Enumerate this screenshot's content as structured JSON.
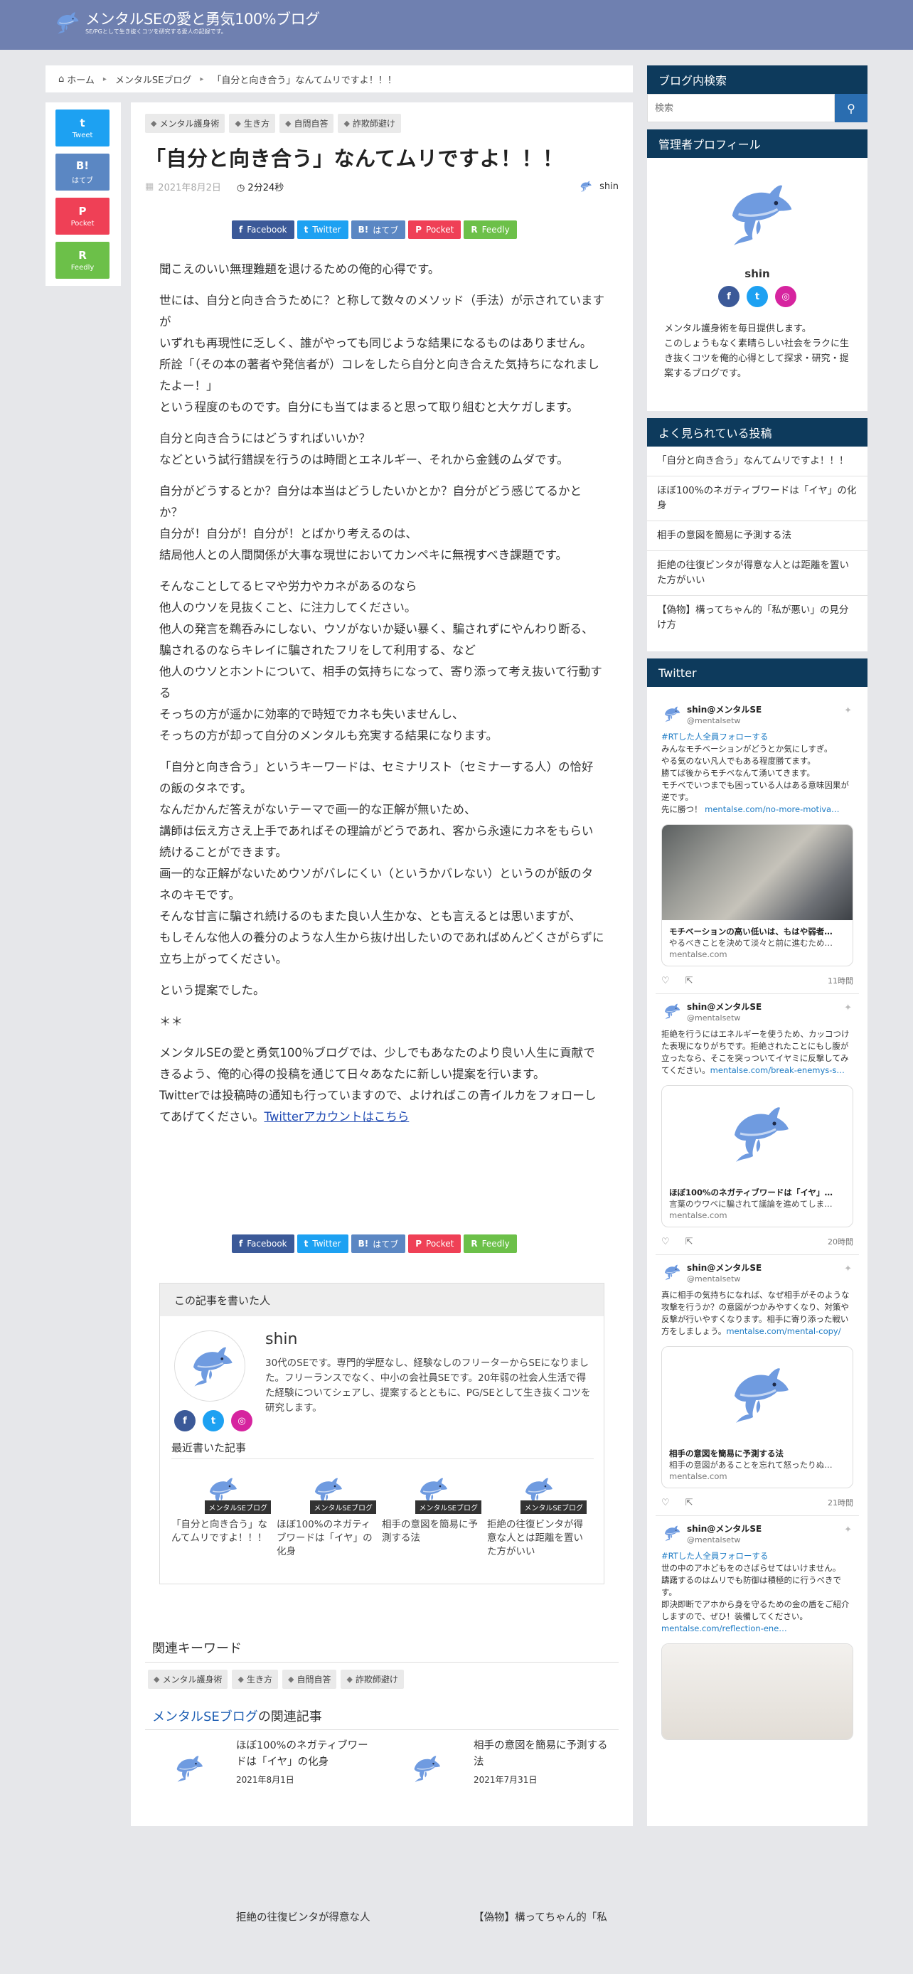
{
  "header": {
    "title": "メンタルSEの愛と勇気100%ブログ",
    "subtitle": "SE/PGとして生き抜くコツを研究する愛人の記録です。"
  },
  "breadcrumb": {
    "home": "ホーム",
    "category": "メンタルSEブログ",
    "current": "「自分と向き合う」なんてムリですよ！！！"
  },
  "share_vertical": [
    {
      "icon": "t",
      "label": "Tweet"
    },
    {
      "icon": "B!",
      "label": "はてブ"
    },
    {
      "icon": "P",
      "label": "Pocket"
    },
    {
      "icon": "R",
      "label": "Feedly"
    }
  ],
  "share_row": [
    {
      "icon": "f",
      "label": "Facebook"
    },
    {
      "icon": "t",
      "label": "Twitter"
    },
    {
      "icon": "B!",
      "label": "はてブ"
    },
    {
      "icon": "P",
      "label": "Pocket"
    },
    {
      "icon": "R",
      "label": "Feedly"
    }
  ],
  "post": {
    "tags": [
      "メンタル護身術",
      "生き方",
      "自問自答",
      "詐欺師避け"
    ],
    "title": "「自分と向き合う」なんてムリですよ！！！",
    "date": "2021年8月2日",
    "read_time": "2分24秒",
    "author": "shin",
    "paragraphs": [
      "聞こえのいい無理難題を退けるための俺的心得です。",
      "世には、自分と向き合うために？と称して数々のメソッド（手法）が示されていますが\nいずれも再現性に乏しく、誰がやっても同じような結果になるものはありません。\n所詮「（その本の著者や発信者が）コレをしたら自分と向き合えた気持ちになれましたよー！」\nという程度のものです。自分にも当てはまると思って取り組むと大ケガします。",
      "自分と向き合うにはどうすればいいか？\nなどという試行錯誤を行うのは時間とエネルギー、それから金銭のムダです。",
      "自分がどうするとか？自分は本当はどうしたいかとか？自分がどう感じてるかとか？\n自分が！自分が！自分が！とばかり考えるのは、\n結局他人との人間関係が大事な現世においてカンペキに無視すべき課題です。",
      "そんなことしてるヒマや労力やカネがあるのなら\n他人のウソを見抜くこと、に注力してください。\n他人の発言を鵜呑みにしない、ウソがないか疑い暴く、騙されずにやんわり断る、\n騙されるのならキレイに騙されたフリをして利用する、など\n他人のウソとホントについて、相手の気持ちになって、寄り添って考え抜いて行動する\nそっちの方が遥かに効率的で時短でカネも失いませんし、\nそっちの方が却って自分のメンタルも充実する結果になります。",
      "「自分と向き合う」というキーワードは、セミナリスト（セミナーする人）の恰好の飯のタネです。\nなんだかんだ答えがないテーマで画一的な正解が無いため、\n講師は伝え方さえ上手であればその理論がどうであれ、客から永遠にカネをもらい続けることができます。\n画一的な正解がないためウソがバレにくい（というかバレない）というのが飯のタネのキモです。\nそんな甘言に騙され続けるのもまた良い人生かな、とも言えるとは思いますが、\nもしそんな他人の養分のような人生から抜け出したいのであればめんどくさがらずに立ち上がってください。",
      "という提案でした。",
      "＊＊",
      "メンタルSEの愛と勇気100％ブログでは、少しでもあなたのより良い人生に貢献できるよう、俺的心得の投稿を通じて日々あなたに新しい提案を行います。\nTwitterでは投稿時の通知も行っていますので、よければこの青イルカをフォローしてあげてください。"
    ],
    "twitter_link": "Twitterアカウントはこちら"
  },
  "author_box": {
    "heading": "この記事を書いた人",
    "name": "shin",
    "description": "30代のSEです。専門的学歴なし、経験なしのフリーターからSEになりました。フリーランスでなく、中小の会社員SEです。20年弱の社会人生活で得た経験についてシェアし、提案するとともに、PG/SEとして生き抜くコツを研究します。",
    "recent_heading": "最近書いた記事",
    "recent": [
      {
        "badge": "メンタルSEブログ",
        "title": "「自分と向き合う」なんてムリですよ！！！"
      },
      {
        "badge": "メンタルSEブログ",
        "title": "ほぼ100%のネガティブワードは「イヤ」の化身"
      },
      {
        "badge": "メンタルSEブログ",
        "title": "相手の意図を簡易に予測する法"
      },
      {
        "badge": "メンタルSEブログ",
        "title": "拒絶の往復ビンタが得意な人とは距離を置いた方がいい"
      }
    ]
  },
  "keywords": {
    "heading": "関連キーワード",
    "tags": [
      "メンタル護身術",
      "生き方",
      "自問自答",
      "詐欺師避け"
    ]
  },
  "related": {
    "heading_accent": "メンタルSEブログ",
    "heading_rest": "の関連記事",
    "items": [
      {
        "title": "ほぼ100%のネガティブワードは「イヤ」の化身",
        "date": "2021年8月1日"
      },
      {
        "title": "相手の意図を簡易に予測する法",
        "date": "2021年7月31日"
      },
      {
        "title": "拒絶の往復ビンタが得意な人",
        "date": ""
      },
      {
        "title": "【偽物】構ってちゃん的「私",
        "date": ""
      }
    ]
  },
  "sidebar": {
    "search": {
      "heading": "ブログ内検索",
      "placeholder": "検索"
    },
    "profile": {
      "heading": "管理者プロフィール",
      "name": "shin",
      "description": "メンタル護身術を毎日提供します。\nこのしょうもなく素晴らしい社会をラクに生き抜くコツを俺的心得として探求・研究・提案するブログです。"
    },
    "popular": {
      "heading": "よく見られている投稿",
      "items": [
        "「自分と向き合う」なんてムリですよ！！！",
        "ほぼ100%のネガティブワードは「イヤ」の化身",
        "相手の意図を簡易に予測する法",
        "拒絶の往復ビンタが得意な人とは距離を置いた方がいい",
        "【偽物】構ってちゃん的「私が悪い」の見分け方"
      ]
    },
    "twitter": {
      "heading": "Twitter",
      "tweets": [
        {
          "name": "shin@メンタルSE",
          "handle": "@mentalsetw",
          "hashtag": "#RTした人全員フォローする",
          "text": "みんなモチベーションがどうとか気にしすぎ。\nやる気のない凡人でもある程度勝てます。\n勝てば後からモチベなんて湧いてきます。\nモチベでいつまでも困っている人はある意味因果が逆です。\n先に勝つ！",
          "link": "mentalse.com/no-more-motiva…",
          "card_title": "モチベーションの高い低いは、もはや弱者…",
          "card_desc": "やるべきことを決めて淡々と前に進むため…",
          "card_url": "mentalse.com",
          "time": "11時間"
        },
        {
          "name": "shin@メンタルSE",
          "handle": "@mentalsetw",
          "hashtag": "",
          "text": "拒絶を行うにはエネルギーを使うため、カッコつけた表現になりがちです。拒絶されたことにもし腹が立ったなら、そこを突っついてイヤミに反撃してみてください。",
          "link": "mentalse.com/break-enemys-s…",
          "card_title": "ほぼ100%のネガティブワードは「イヤ」…",
          "card_desc": "言葉のウワベに騙されて議論を進めてしま…",
          "card_url": "mentalse.com",
          "time": "20時間"
        },
        {
          "name": "shin@メンタルSE",
          "handle": "@mentalsetw",
          "hashtag": "",
          "text": "真に相手の気持ちになれば、なぜ相手がそのような攻撃を行うか？の意図がつかみやすくなり、対策や反撃が行いやすくなります。相手に寄り添った戦い方をしましょう。",
          "link": "mentalse.com/mental-copy/",
          "card_title": "相手の意図を簡易に予測する法",
          "card_desc": "相手の意図があることを忘れて怒ったりぬ…",
          "card_url": "mentalse.com",
          "time": "21時間"
        },
        {
          "name": "shin@メンタルSE",
          "handle": "@mentalsetw",
          "hashtag": "#RTした人全員フォローする",
          "text": "世の中のアホどもをのさばらせてはいけません。\n躊躇するのはムリでも防御は積極的に行うべきです。\n即決即断でアホから身を守るための金の盾をご紹介しますので、ぜひ！装備してください。",
          "link": "mentalse.com/reflection-ene…",
          "card_title": "",
          "card_desc": "",
          "card_url": "",
          "time": ""
        }
      ]
    }
  },
  "colors": {
    "header": "#6f80b0",
    "sidebar_head": "#0d3a5c",
    "twitter": "#1da1f2",
    "hatena": "#5b87c3",
    "pocket": "#ef4056",
    "feedly": "#6cc049",
    "facebook": "#3b5998",
    "instagram": "#d6249f"
  }
}
